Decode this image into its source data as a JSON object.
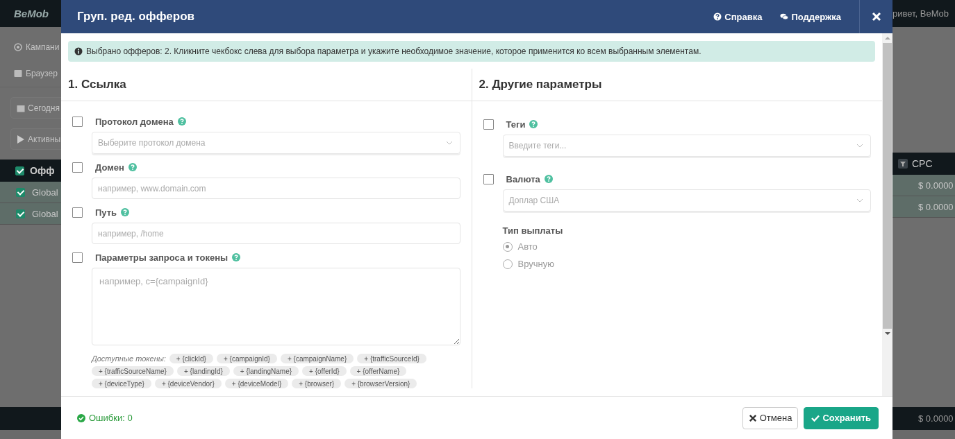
{
  "background": {
    "logo": "BeMob",
    "nav": [
      {
        "label": "Кампани",
        "kind": "campaigns"
      },
      {
        "label": "Браузер",
        "kind": "browser"
      }
    ],
    "filters": [
      {
        "label": "Сегодня",
        "kind": "date"
      },
      {
        "label": "Активны",
        "kind": "play"
      }
    ],
    "table": {
      "all_checked": true,
      "header": "Офф",
      "rows": [
        {
          "name": "Global",
          "checked": true
        },
        {
          "name": "Global",
          "checked": true
        }
      ]
    },
    "greeting": "ривет, BeMob",
    "cpc_header": "CPC",
    "cpc_values": [
      "$ 0.0000",
      "$ 0.0000"
    ],
    "total": "$ 0.0000"
  },
  "modal": {
    "title": "Груп. ред. офферов",
    "links": [
      {
        "label": "Справка",
        "kind": "help"
      },
      {
        "label": "Поддержка",
        "kind": "support"
      }
    ],
    "alert": "Выбрано офферов: 2. Кликните чекбокс слева для выбора параметра и укажите необходимое значение, которое применится ко всем выбранным элементам.",
    "sections": [
      {
        "title": "1. Ссылка",
        "fields": [
          {
            "kind": "select",
            "label": "Протокол домена",
            "checked": false,
            "placeholder": "Выберите протокол домена"
          },
          {
            "kind": "input",
            "label": "Домен",
            "checked": false,
            "placeholder": "например, www.domain.com"
          },
          {
            "kind": "input",
            "label": "Путь",
            "checked": false,
            "placeholder": "например, /home"
          },
          {
            "kind": "textarea",
            "label": "Параметры запроса и токены",
            "checked": false,
            "placeholder": "например, c={campaignId}",
            "tokens_label": "Доступные токены:",
            "tokens": [
              "+ {clickId}",
              "+ {campaignId}",
              "+ {campaignName}",
              "+ {trafficSourceId}",
              "+ {trafficSourceName}",
              "+ {landingId}",
              "+ {landingName}",
              "+ {offerId}",
              "+ {offerName}",
              "+ {deviceType}",
              "+ {deviceVendor}",
              "+ {deviceModel}",
              "+ {browser}",
              "+ {browserVersion}"
            ]
          }
        ]
      },
      {
        "title": "2. Другие параметры",
        "fields": [
          {
            "kind": "select",
            "label": "Теги",
            "checked": false,
            "placeholder": "Введите теги..."
          },
          {
            "kind": "select",
            "label": "Валюта",
            "checked": false,
            "value": "Доплар США",
            "payout": {
              "label": "Тип выплаты",
              "options": [
                {
                  "label": "Авто",
                  "selected": true
                },
                {
                  "label": "Вручную",
                  "selected": false
                }
              ]
            }
          }
        ]
      }
    ],
    "errors": "Ошибки: 0",
    "buttons": [
      {
        "label": "Отмена",
        "kind": "cancel"
      },
      {
        "label": "Сохранить",
        "kind": "save"
      }
    ]
  }
}
